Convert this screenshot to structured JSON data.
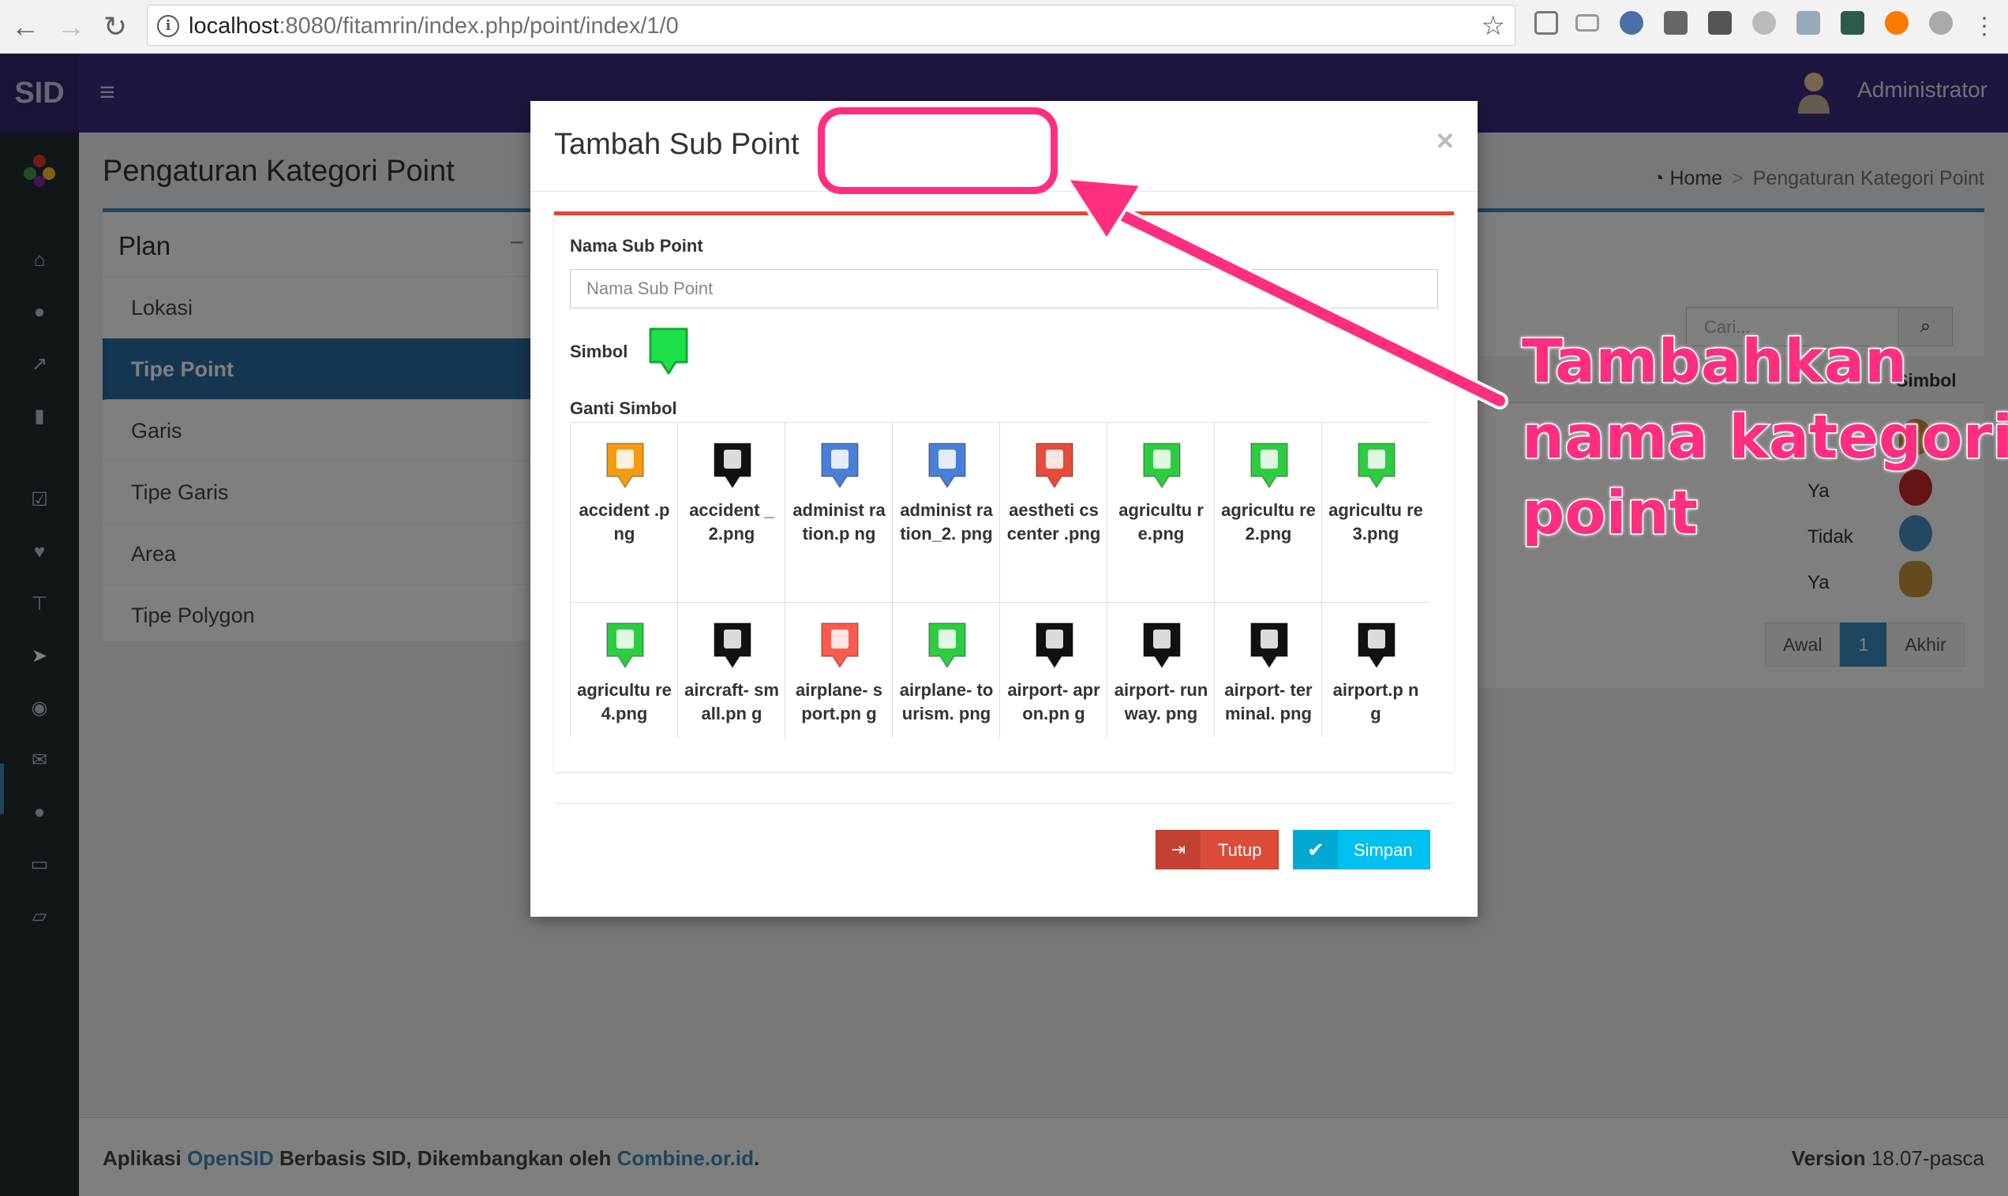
{
  "browser": {
    "url_host": "localhost",
    "url_rest": ":8080/fitamrin/index.php/point/index/1/0"
  },
  "header": {
    "brand": "SID",
    "user": "Administrator"
  },
  "content": {
    "title": "Pengaturan Kategori Point",
    "breadcrumb_home": "Home",
    "breadcrumb_current": "Pengaturan Kategori Point",
    "plan_title": "Plan",
    "plan_items": [
      "Lokasi",
      "Tipe Point",
      "Garis",
      "Tipe Garis",
      "Area",
      "Tipe Polygon"
    ],
    "search_placeholder": "Cari...",
    "col_simbol": "Simbol",
    "rows": [
      "Ya",
      "Tidak",
      "Ya"
    ],
    "pager": [
      "Awal",
      "1",
      "Akhir"
    ]
  },
  "modal": {
    "title": "Tambah Sub Point",
    "close": "×",
    "name_label": "Nama Sub Point",
    "name_placeholder": "Nama Sub Point",
    "symbol_label": "Simbol",
    "change_symbol_label": "Ganti Simbol",
    "icons": [
      {
        "name": "accident .png",
        "color": "#f39c12"
      },
      {
        "name": "accident _2.png",
        "color": "#111111"
      },
      {
        "name": "administ ration.p ng",
        "color": "#4a7fd8"
      },
      {
        "name": "administ ration_2. png",
        "color": "#4a7fd8"
      },
      {
        "name": "aestheti cscenter .png",
        "color": "#e74c3c"
      },
      {
        "name": "agricultu re.png",
        "color": "#2ecc40"
      },
      {
        "name": "agricultu re2.png",
        "color": "#2ecc40"
      },
      {
        "name": "agricultu re3.png",
        "color": "#2ecc40"
      },
      {
        "name": "agricultu re4.png",
        "color": "#2ecc40"
      },
      {
        "name": "aircraft- small.pn g",
        "color": "#111111"
      },
      {
        "name": "airplane- sport.pn g",
        "color": "#ff5a4e"
      },
      {
        "name": "airplane- tourism. png",
        "color": "#2ecc40"
      },
      {
        "name": "airport- apron.pn g",
        "color": "#111111"
      },
      {
        "name": "airport- runway. png",
        "color": "#111111"
      },
      {
        "name": "airport- terminal. png",
        "color": "#111111"
      },
      {
        "name": "airport.p ng",
        "color": "#111111"
      }
    ],
    "btn_close": "Tutup",
    "btn_save": "Simpan"
  },
  "footer": {
    "prefix": "Aplikasi ",
    "opensid": "OpenSID",
    "middle": " Berbasis SID, Dikembangkan oleh ",
    "combine": "Combine.or.id",
    "suffix": ".",
    "version_label": "Version",
    "version": " 18.07-pasca"
  },
  "annotation": {
    "lines": [
      "Tambahkan",
      "nama kategori",
      "point"
    ]
  },
  "colors": {
    "header": "#3b2e7e",
    "sidebar": "#222d32",
    "accent": "#3c8dbc",
    "danger": "#dd4b39",
    "info": "#00c0ef",
    "annotation": "#ff2e7e"
  }
}
